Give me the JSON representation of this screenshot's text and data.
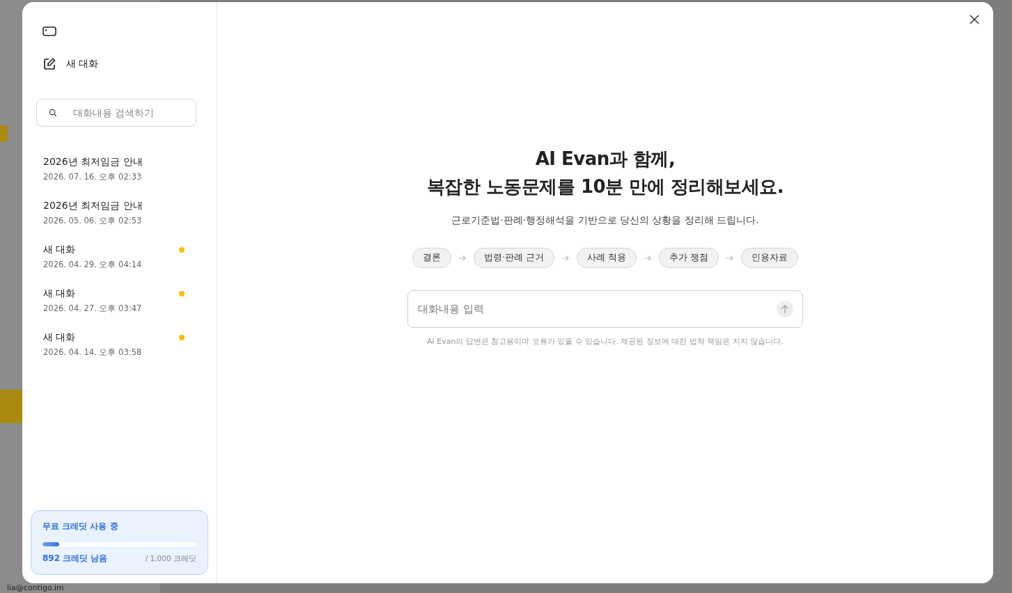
{
  "background": {
    "user_email": "lia@contigo.im"
  },
  "sidebar": {
    "new_chat": "새 대화",
    "search": {
      "placeholder": "대화내용 검색하기"
    },
    "conversations": [
      {
        "title": "2026년 최저임금 안내",
        "date": "2026. 07. 16. 오후 02:33",
        "unread": false
      },
      {
        "title": "2026년 최저임금 안내",
        "date": "2026. 05. 06. 오후 02:53",
        "unread": false
      },
      {
        "title": "새 대화",
        "date": "2026. 04. 29. 오후 04:14",
        "unread": true
      },
      {
        "title": "새 대화",
        "date": "2026. 04. 27. 오후 03:47",
        "unread": true
      },
      {
        "title": "새 대화",
        "date": "2026. 04. 14. 오후 03:58",
        "unread": true
      }
    ],
    "credits": {
      "title": "무료 크레딧 사용 중",
      "level": 0.11,
      "remaining": "892 크레딧 남음",
      "total": "/ 1,000 크레딧"
    }
  },
  "main": {
    "heading_lines": [
      "AI Evan과 함께,",
      "복잡한 노동문제를 10분 만에 정리해보세요."
    ],
    "subtitle": "근로기준법·판례·행정해석을 기반으로 당신의 상황을 정리해 드립니다.",
    "steps": [
      "결론",
      "법령·판례 근거",
      "사례 적용",
      "추가 쟁점",
      "인용자료"
    ],
    "input": {
      "placeholder": "대화내용 입력"
    },
    "disclaimer": "AI Evan의 답변은 참고용이며 오류가 있을 수 있습니다. 제공된 정보에 대한 법적 책임은 지지 않습니다."
  }
}
